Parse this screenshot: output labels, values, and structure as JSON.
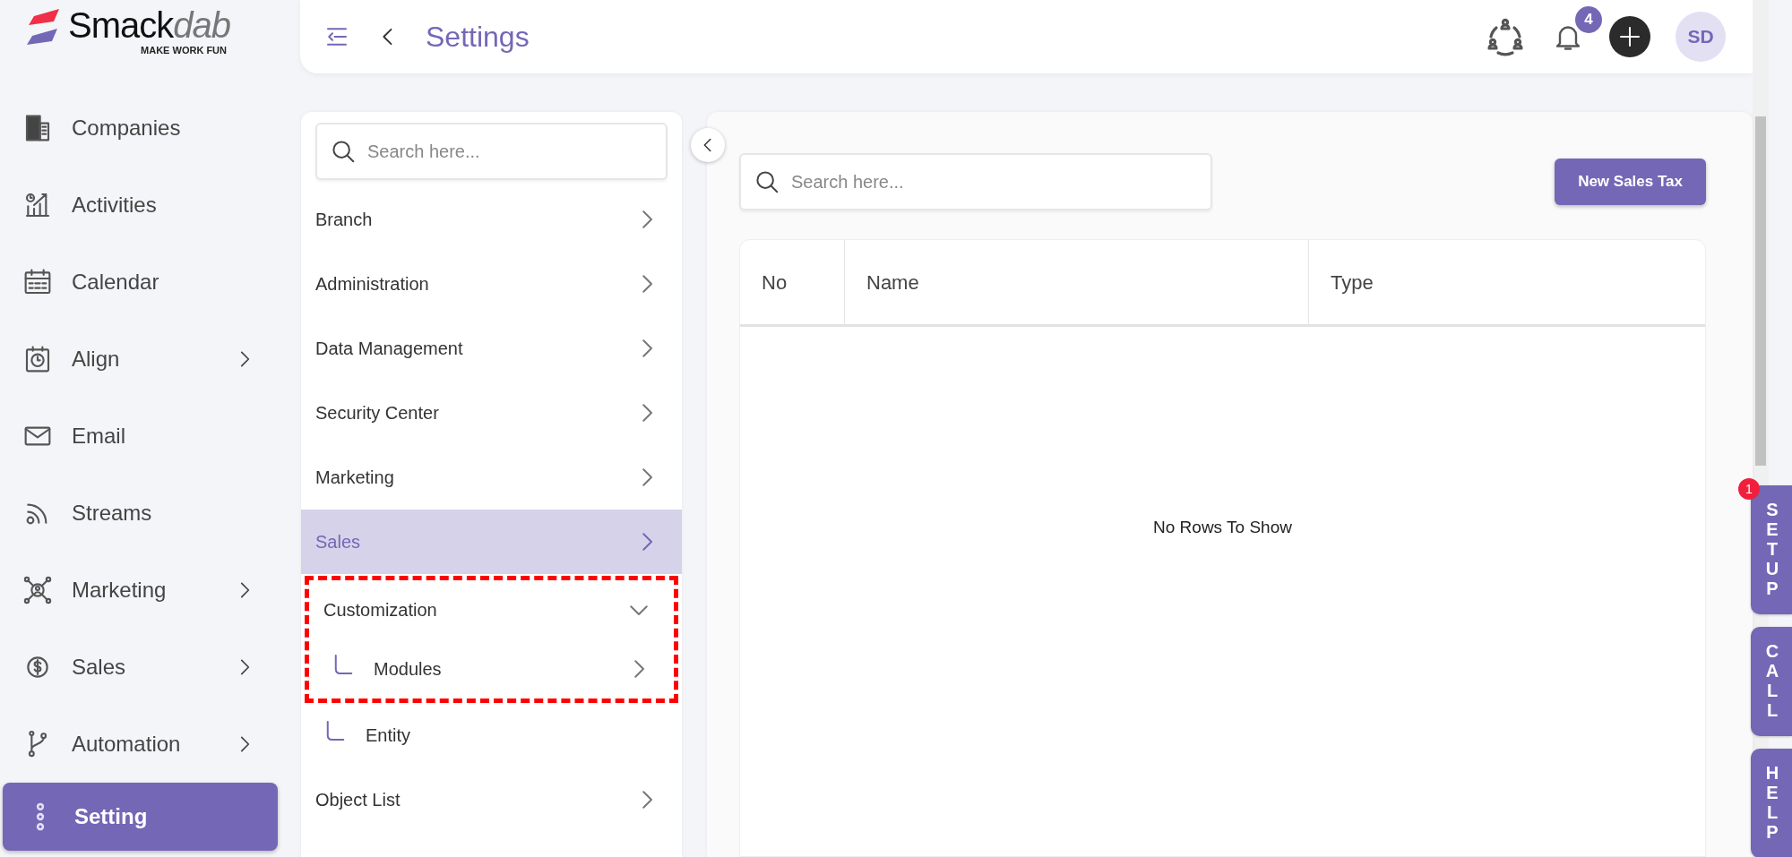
{
  "logo": {
    "name_first": "Smack",
    "name_second": "dab",
    "tagline": "MAKE WORK FUN"
  },
  "sidebar": {
    "items": [
      {
        "label": "Companies",
        "has_submenu": false,
        "selected": false
      },
      {
        "label": "Activities",
        "has_submenu": false,
        "selected": false
      },
      {
        "label": "Calendar",
        "has_submenu": false,
        "selected": false
      },
      {
        "label": "Align",
        "has_submenu": true,
        "selected": false
      },
      {
        "label": "Email",
        "has_submenu": false,
        "selected": false
      },
      {
        "label": "Streams",
        "has_submenu": false,
        "selected": false
      },
      {
        "label": "Marketing",
        "has_submenu": true,
        "selected": false
      },
      {
        "label": "Sales",
        "has_submenu": true,
        "selected": false
      },
      {
        "label": "Automation",
        "has_submenu": true,
        "selected": false
      },
      {
        "label": "Setting",
        "has_submenu": false,
        "selected": true
      }
    ]
  },
  "header": {
    "title": "Settings",
    "notification_count": "4",
    "avatar_initials": "SD"
  },
  "settings_menu": {
    "search": {
      "placeholder": "Search here..."
    },
    "items": [
      {
        "label": "Branch",
        "expandable": true,
        "expanded": false,
        "selected": false,
        "highlighted": false
      },
      {
        "label": "Administration",
        "expandable": true,
        "expanded": false,
        "selected": false,
        "highlighted": false
      },
      {
        "label": "Data Management",
        "expandable": true,
        "expanded": false,
        "selected": false,
        "highlighted": false
      },
      {
        "label": "Security Center",
        "expandable": true,
        "expanded": false,
        "selected": false,
        "highlighted": false
      },
      {
        "label": "Marketing",
        "expandable": true,
        "expanded": false,
        "selected": false,
        "highlighted": false
      },
      {
        "label": "Sales",
        "expandable": true,
        "expanded": false,
        "selected": true,
        "highlighted": false
      },
      {
        "label": "Customization",
        "expandable": true,
        "expanded": true,
        "selected": false,
        "highlighted": true,
        "children": [
          {
            "label": "Modules",
            "expandable": true,
            "selected": false,
            "highlighted": true
          },
          {
            "label": "Entity",
            "expandable": false,
            "selected": false,
            "highlighted": false
          }
        ]
      },
      {
        "label": "Object List",
        "expandable": true,
        "expanded": false,
        "selected": false,
        "highlighted": false
      }
    ]
  },
  "content": {
    "search": {
      "placeholder": "Search here..."
    },
    "new_button": "New Sales Tax",
    "table": {
      "columns": [
        "No",
        "Name",
        "Type"
      ],
      "empty_message": "No Rows To Show"
    }
  },
  "side_tabs": [
    {
      "label": "SETUP",
      "badge": "1"
    },
    {
      "label": "CALL"
    },
    {
      "label": "HELP"
    }
  ]
}
